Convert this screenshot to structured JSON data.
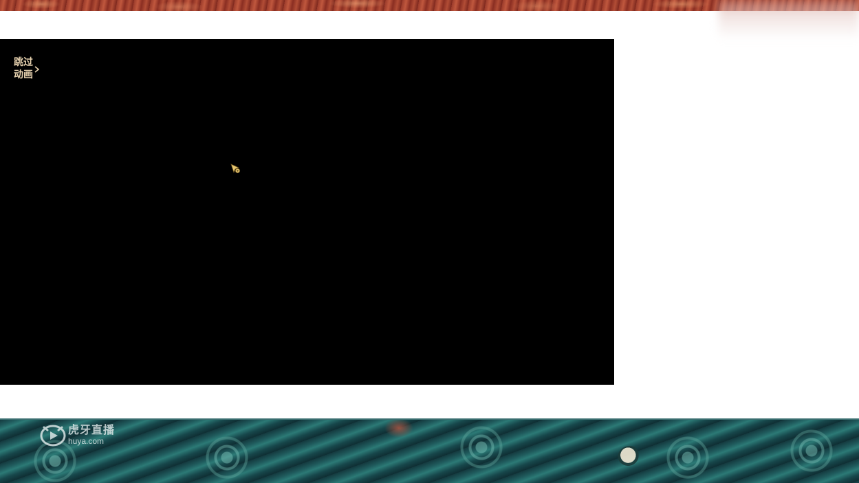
{
  "page": {
    "background_color": "#ffffff"
  },
  "top_banner": {
    "pattern": "red-swirl-decoration",
    "color": "#9a3a2a"
  },
  "video_player": {
    "background_color": "#000000",
    "skip_animation_button": {
      "icon": "skip-animation-icon",
      "label_line1": "跳过",
      "label_line2": "动画",
      "color": "#e8d3b0"
    },
    "cursor": {
      "icon": "pointer-cursor-icon",
      "color": "#e8c770"
    }
  },
  "bottom_banner": {
    "pattern": "teal-wave-decoration",
    "color": "#1f5a5c",
    "watermark": {
      "icon": "huya-logo-icon",
      "name_cn": "虎牙直播",
      "domain": "huya.com"
    }
  }
}
